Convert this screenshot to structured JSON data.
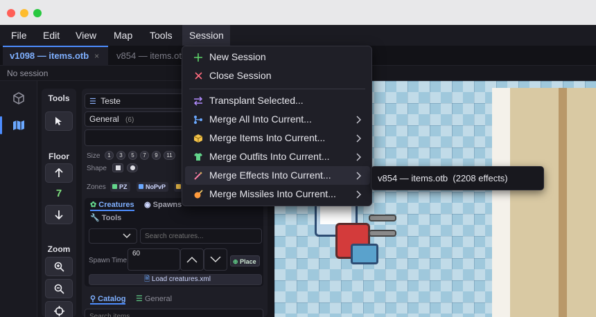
{
  "menubar": {
    "items": [
      "File",
      "Edit",
      "View",
      "Map",
      "Tools",
      "Session"
    ]
  },
  "tabs": [
    {
      "label": "v1098 — items.otb",
      "close": "×"
    },
    {
      "label": "v854 — items.otb"
    }
  ],
  "status": {
    "text": "No session"
  },
  "tools_column": {
    "tools_title": "Tools",
    "floor_title": "Floor",
    "floor_value": "7",
    "zoom_title": "Zoom"
  },
  "panel": {
    "palette_select": "Teste",
    "category_select": "General",
    "category_count": "(6)",
    "size_label": "Size",
    "sizes": [
      "1",
      "3",
      "5",
      "7",
      "9",
      "11"
    ],
    "shape_label": "Shape",
    "zones_label": "Zones",
    "zones": [
      "PZ",
      "NoPvP"
    ],
    "creatures_tab": "Creatures",
    "spawns_tab": "Spawns",
    "tools_tab": "Tools",
    "search_creatures_placeholder": "Search creatures...",
    "spawn_time_label": "Spawn Time",
    "spawn_time_value": "60",
    "place_button": "Place",
    "load_button": "Load creatures.xml",
    "catalog_tab": "Catalog",
    "general_tab": "General",
    "search_items_placeholder": "Search items..."
  },
  "session_menu": {
    "items": [
      {
        "label": "New Session",
        "icon": "plus-icon",
        "color": "#5ed46a"
      },
      {
        "label": "Close Session",
        "icon": "close-icon",
        "color": "#ff6b7d"
      },
      {
        "label": "Transplant Selected...",
        "icon": "swap-arrows-icon",
        "color": "#b28cff"
      },
      {
        "label": "Merge All Into Current...",
        "icon": "merge-icon",
        "color": "#6aa8ff"
      },
      {
        "label": "Merge Items Into Current...",
        "icon": "box-icon",
        "color": "#f3c24a"
      },
      {
        "label": "Merge Outfits Into Current...",
        "icon": "shirt-icon",
        "color": "#63d58b"
      },
      {
        "label": "Merge Effects Into Current...",
        "icon": "magic-wand-icon",
        "color": "#ff7fa6"
      },
      {
        "label": "Merge Missiles Into Current...",
        "icon": "missile-icon",
        "color": "#ff9a3c"
      }
    ]
  },
  "tooltip": {
    "text": "v854 — items.otb  (2208 effects)"
  },
  "colors": {
    "accent": "#4d8dff",
    "floor": "#7fe07f",
    "hover": "#2c2c37"
  }
}
